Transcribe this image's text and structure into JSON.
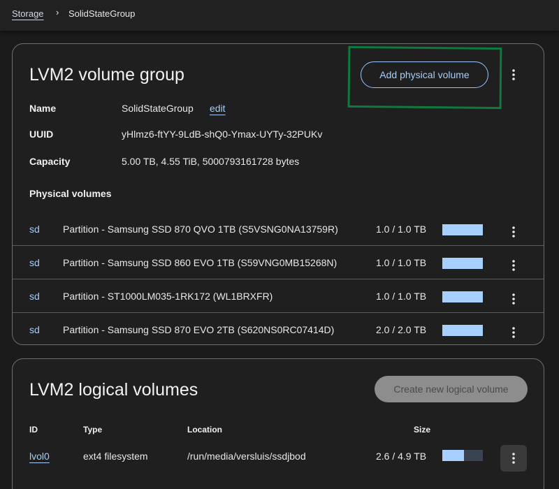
{
  "breadcrumb": {
    "root": "Storage",
    "separator": "›",
    "current": "SolidStateGroup"
  },
  "volume_group": {
    "title": "LVM2 volume group",
    "add_button": "Add physical volume",
    "fields": {
      "name_label": "Name",
      "name_value": "SolidStateGroup",
      "edit_label": "edit",
      "uuid_label": "UUID",
      "uuid_value": "yHlmz6-ftYY-9LdB-shQ0-Ymax-UYTy-32PUKv",
      "capacity_label": "Capacity",
      "capacity_value": "5.00 TB, 4.55 TiB, 5000793161728 bytes"
    },
    "physical_volumes_heading": "Physical volumes",
    "physical_volumes": [
      {
        "link": "sd",
        "description": "Partition - Samsung SSD 870 QVO 1TB (S5VSNG0NA13759R)",
        "size": "1.0 / 1.0 TB",
        "usage": 1.0
      },
      {
        "link": "sd",
        "description": "Partition - Samsung SSD 860 EVO 1TB (S59VNG0MB15268N)",
        "size": "1.0 / 1.0 TB",
        "usage": 1.0
      },
      {
        "link": "sd",
        "description": "Partition - ST1000LM035-1RK172 (WL1BRXFR)",
        "size": "1.0 / 1.0 TB",
        "usage": 1.0
      },
      {
        "link": "sd",
        "description": "Partition - Samsung SSD 870 EVO 2TB (S620NS0RC07414D)",
        "size": "2.0 / 2.0 TB",
        "usage": 1.0
      }
    ]
  },
  "logical_volumes": {
    "title": "LVM2 logical volumes",
    "create_button": "Create new logical volume",
    "columns": {
      "id": "ID",
      "type": "Type",
      "location": "Location",
      "size": "Size"
    },
    "rows": [
      {
        "id": "lvol0",
        "type": "ext4 filesystem",
        "location": "/run/media/versluis/ssdjbod",
        "size": "2.6 / 4.9 TB",
        "usage": 0.53
      }
    ]
  },
  "colors": {
    "accent": "#a8cdfa",
    "bar_fill": "#a6d0ff",
    "highlight": "#0f7a3e"
  }
}
